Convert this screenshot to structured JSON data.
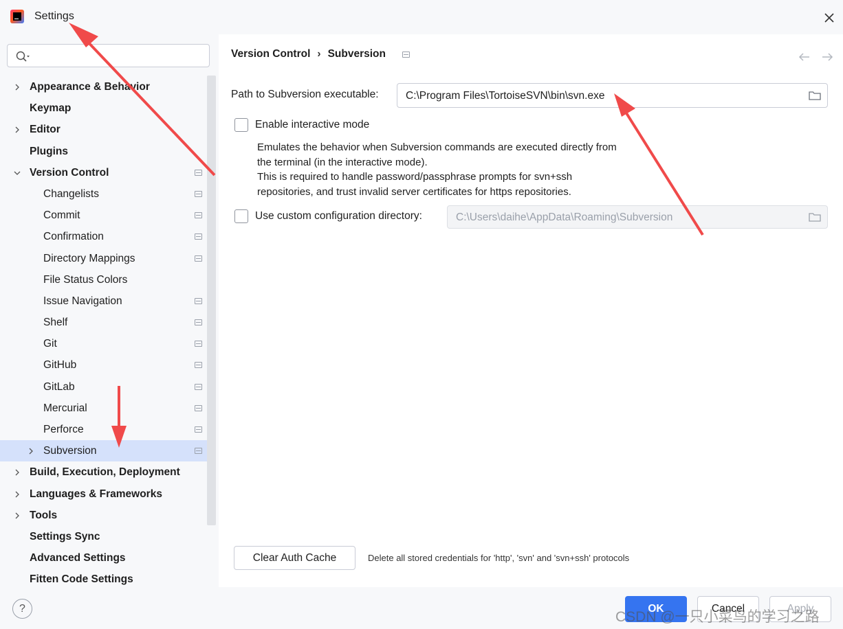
{
  "window": {
    "title": "Settings"
  },
  "search": {
    "placeholder": ""
  },
  "sidebar": {
    "items": [
      {
        "label": "Appearance & Behavior"
      },
      {
        "label": "Keymap"
      },
      {
        "label": "Editor"
      },
      {
        "label": "Plugins"
      },
      {
        "label": "Version Control"
      },
      {
        "label": "Changelists"
      },
      {
        "label": "Commit"
      },
      {
        "label": "Confirmation"
      },
      {
        "label": "Directory Mappings"
      },
      {
        "label": "File Status Colors"
      },
      {
        "label": "Issue Navigation"
      },
      {
        "label": "Shelf"
      },
      {
        "label": "Git"
      },
      {
        "label": "GitHub"
      },
      {
        "label": "GitLab"
      },
      {
        "label": "Mercurial"
      },
      {
        "label": "Perforce"
      },
      {
        "label": "Subversion"
      },
      {
        "label": "Build, Execution, Deployment"
      },
      {
        "label": "Languages & Frameworks"
      },
      {
        "label": "Tools"
      },
      {
        "label": "Settings Sync"
      },
      {
        "label": "Advanced Settings"
      },
      {
        "label": "Fitten Code Settings"
      }
    ]
  },
  "breadcrumb": {
    "parent": "Version Control",
    "separator": "›",
    "current": "Subversion"
  },
  "main": {
    "path_label": "Path to Subversion executable:",
    "path_value": "C:\\Program Files\\TortoiseSVN\\bin\\svn.exe",
    "interactive_label": "Enable interactive mode",
    "description": [
      "Emulates the behavior when Subversion commands are executed directly from",
      "the terminal (in the interactive mode).",
      "This is required to handle password/passphrase prompts for svn+ssh",
      "repositories, and trust invalid server certificates for https repositories."
    ],
    "custom_config_label": "Use custom configuration directory:",
    "custom_config_value": "C:\\Users\\daihe\\AppData\\Roaming\\Subversion",
    "clear_cache_label": "Clear Auth Cache",
    "clear_cache_hint": "Delete all stored credentials for 'http', 'svn' and 'svn+ssh' protocols"
  },
  "footer": {
    "help": "?",
    "ok": "OK",
    "cancel": "Cancel",
    "apply": "Apply"
  },
  "watermark": "CSDN @一只小菜鸟的学习之路",
  "colors": {
    "accent": "#3574f0",
    "selection": "#d5e1fb",
    "annotation_arrow": "#f04a4a"
  }
}
